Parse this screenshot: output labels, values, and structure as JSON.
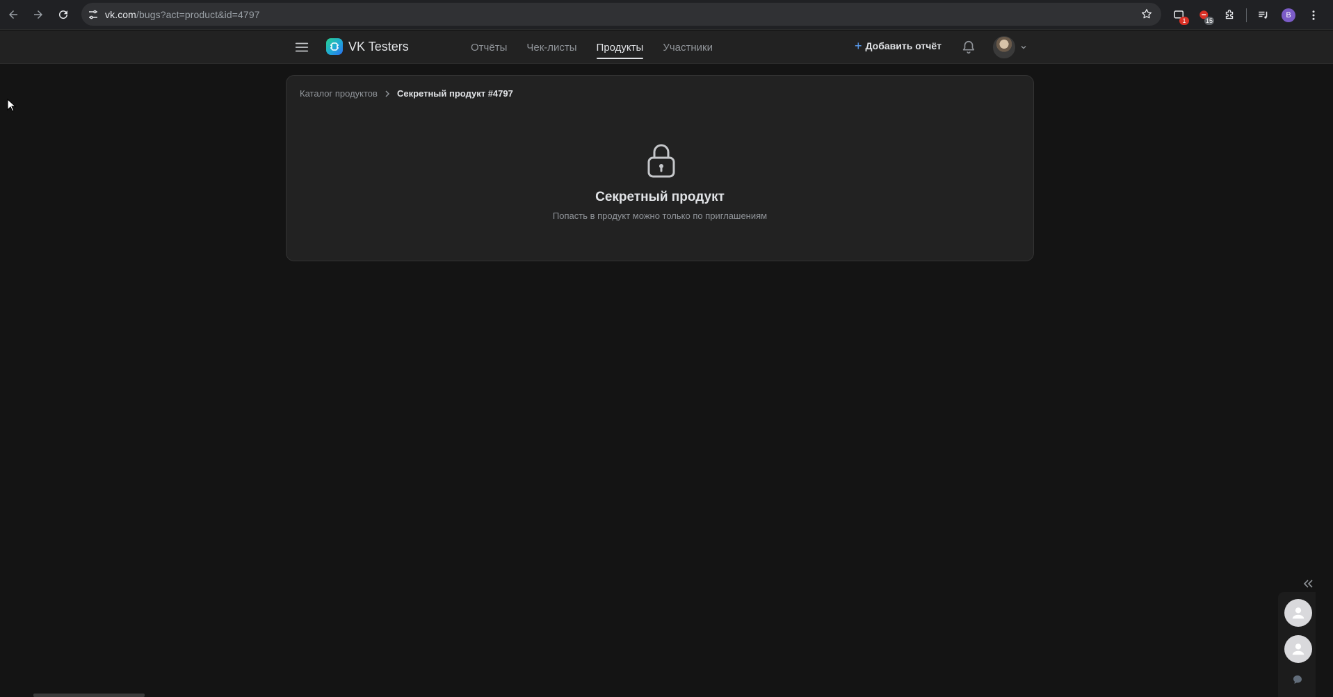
{
  "browser": {
    "url_host": "vk.com",
    "url_path": "/bugs?act=product&id=4797",
    "extensions": [
      {
        "icon": "extension-screen-icon",
        "badge": "1",
        "badge_color": "#d93025"
      },
      {
        "icon": "extension-red-icon",
        "badge": "15",
        "badge_color": "#5f6368"
      }
    ],
    "profile_letter": "В"
  },
  "header": {
    "logo_text": "VK Testers",
    "tabs": [
      {
        "label": "Отчёты",
        "active": false
      },
      {
        "label": "Чек-листы",
        "active": false
      },
      {
        "label": "Продукты",
        "active": true
      },
      {
        "label": "Участники",
        "active": false
      }
    ],
    "add_report_label": "Добавить отчёт"
  },
  "breadcrumb": {
    "parent": "Каталог продуктов",
    "current": "Секретный продукт #4797"
  },
  "content": {
    "title": "Секретный продукт",
    "subtitle": "Попасть в продукт можно только по приглашениям"
  },
  "colors": {
    "background": "#141414",
    "card": "#222222",
    "accent": "#5a9cf0"
  }
}
